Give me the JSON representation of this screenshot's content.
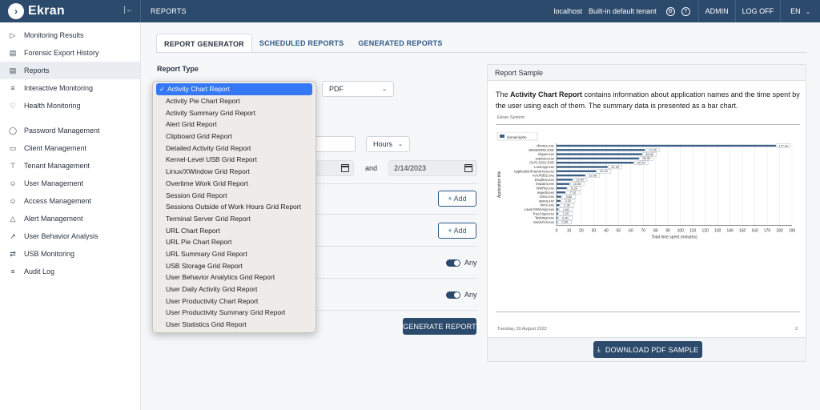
{
  "app": {
    "logo_text": "Ekran"
  },
  "header": {
    "breadcrumb": "REPORTS",
    "host": "localhost",
    "tenant": "Built-in default tenant",
    "user": "ADMIN",
    "logoff": "LOG OFF",
    "language": "EN"
  },
  "sidebar": {
    "items": [
      {
        "label": "Monitoring Results",
        "icon": "play-icon"
      },
      {
        "label": "Forensic Export History",
        "icon": "archive-icon"
      },
      {
        "label": "Reports",
        "icon": "document-icon",
        "active": true
      },
      {
        "label": "Interactive Monitoring",
        "icon": "list-icon"
      },
      {
        "label": "Health Monitoring",
        "icon": "heart-icon"
      },
      {
        "label": "Password Management",
        "icon": "shield-icon"
      },
      {
        "label": "Client Management",
        "icon": "monitor-icon"
      },
      {
        "label": "Tenant Management",
        "icon": "hierarchy-icon"
      },
      {
        "label": "User Management",
        "icon": "user-icon"
      },
      {
        "label": "Access Management",
        "icon": "user-key-icon"
      },
      {
        "label": "Alert Management",
        "icon": "bell-icon"
      },
      {
        "label": "User Behavior Analysis",
        "icon": "chart-icon"
      },
      {
        "label": "USB Monitoring",
        "icon": "usb-icon"
      },
      {
        "label": "Audit Log",
        "icon": "checklist-icon"
      }
    ]
  },
  "tabs": [
    "REPORT GENERATOR",
    "SCHEDULED REPORTS",
    "GENERATED REPORTS"
  ],
  "form": {
    "report_type_label": "Report Type",
    "format_value": "PDF",
    "period_unit": "Hours",
    "and_label": "and",
    "end_date": "2/14/2023",
    "add_label": "+ Add",
    "any_label": "Any",
    "generate_label": "GENERATE REPORT"
  },
  "dropdown": {
    "selected": "Activity Chart Report",
    "options": [
      "Activity Chart Report",
      "Activity Pie Chart Report",
      "Activity Summary Grid Report",
      "Alert Grid Report",
      "Clipboard Grid Report",
      "Detailed Activity Grid Report",
      "Kernel-Level USB Grid Report",
      "Linux/XWindow Grid Report",
      "Overtime Work Grid Report",
      "Session Grid Report",
      "Sessions Outside of Work Hours Grid Report",
      "Terminal Server Grid Report",
      "URL Chart Report",
      "URL Pie Chart Report",
      "URL Summary Grid Report",
      "USB Storage Grid Report",
      "User Behavior Analytics Grid Report",
      "User Daily Activity Grid Report",
      "User Productivity Chart Report",
      "User Productivity Summary Grid Report",
      "User Statistics Grid Report"
    ]
  },
  "sample": {
    "header": "Report Sample",
    "desc_prefix": "The ",
    "desc_bold": "Activity Chart Report",
    "desc_suffix": " contains information about application names and the time spent by the user using each of them. The summary data is presented as a bar chart.",
    "paper_title": "Ekran System",
    "footer_date": "Tuesday, 30 August 2022",
    "footer_page": "2",
    "download_label": "DOWNLOAD PDF SAMPLE"
  },
  "chart_data": {
    "type": "bar",
    "orientation": "horizontal",
    "legend": [
      "domain\\john"
    ],
    "ylabel": "Application title",
    "xlabel": "Total time spent (minutes)",
    "xlim": [
      0,
      190
    ],
    "xticks": [
      0,
      10,
      20,
      30,
      40,
      50,
      60,
      70,
      80,
      90,
      100,
      110,
      120,
      130,
      140,
      150,
      160,
      170,
      180,
      190
    ],
    "categories": [
      "chrome.exe",
      "WINWORD.EXE",
      "Skype.exe",
      "explorer.exe",
      "OUTLOOK.EXE",
      "LockApp.exe",
      "ApplicationFrameHost.exe",
      "AcroRd32.exe",
      "Dropbox.exe",
      "mspaint.exe",
      "WinRar.exe",
      "regedit.exe",
      "notsc.exe",
      "opera.exe",
      "mmc.exe",
      "LaunchWinApp.exe",
      "TrueCrypt.exe",
      "Taskmgr.exe",
      "SearchUI.exe"
    ],
    "values": [
      177,
      71.3,
      69,
      66.5,
      62.2,
      41.2,
      31.9,
      23.08,
      12.9,
      10.5,
      8.2,
      7.1,
      3.8,
      3.2,
      2.3,
      1.5,
      1.2,
      0.9,
      0.5
    ],
    "value_labels": [
      "177.00",
      "71.30",
      "69.00",
      "66.50",
      "62.20",
      "41.20",
      "31.90",
      "23.08",
      "12.90",
      "10.50",
      "8.20",
      "7.10",
      "3.80",
      "3.20",
      "2.30",
      "1.50",
      "1.20",
      "0.90",
      "0.50"
    ],
    "bar_color": "#3b5f86"
  }
}
